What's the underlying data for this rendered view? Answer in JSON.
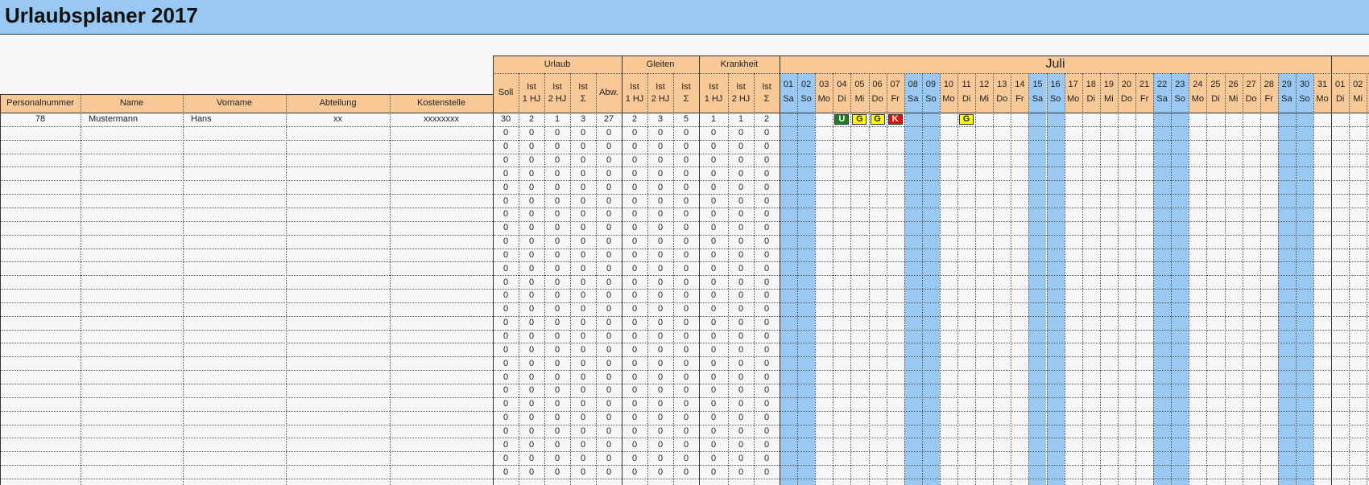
{
  "title": "Urlaubsplaner 2017",
  "groups": {
    "urlaub": "Urlaub",
    "gleiten": "Gleiten",
    "krankheit": "Krankheit"
  },
  "person_headers": [
    "Personalnummer",
    "Name",
    "Vorname",
    "Abteilung",
    "Kostenstelle"
  ],
  "stat_headers": [
    [
      "Soll"
    ],
    [
      "Ist",
      "1 HJ"
    ],
    [
      "Ist",
      "2 HJ"
    ],
    [
      "Ist",
      "Σ"
    ],
    [
      "Abw."
    ],
    [
      "Ist",
      "1 HJ"
    ],
    [
      "Ist",
      "2 HJ"
    ],
    [
      "Ist",
      "Σ"
    ],
    [
      "Ist",
      "1 HJ"
    ],
    [
      "Ist",
      "2 HJ"
    ],
    [
      "Ist",
      "Σ"
    ]
  ],
  "month": "Juli",
  "days": [
    {
      "n": "01",
      "d": "Sa"
    },
    {
      "n": "02",
      "d": "So"
    },
    {
      "n": "03",
      "d": "Mo"
    },
    {
      "n": "04",
      "d": "Di"
    },
    {
      "n": "05",
      "d": "Mi"
    },
    {
      "n": "06",
      "d": "Do"
    },
    {
      "n": "07",
      "d": "Fr"
    },
    {
      "n": "08",
      "d": "Sa"
    },
    {
      "n": "09",
      "d": "So"
    },
    {
      "n": "10",
      "d": "Mo"
    },
    {
      "n": "11",
      "d": "Di"
    },
    {
      "n": "12",
      "d": "Mi"
    },
    {
      "n": "13",
      "d": "Do"
    },
    {
      "n": "14",
      "d": "Fr"
    },
    {
      "n": "15",
      "d": "Sa"
    },
    {
      "n": "16",
      "d": "So"
    },
    {
      "n": "17",
      "d": "Mo"
    },
    {
      "n": "18",
      "d": "Di"
    },
    {
      "n": "19",
      "d": "Mi"
    },
    {
      "n": "20",
      "d": "Do"
    },
    {
      "n": "21",
      "d": "Fr"
    },
    {
      "n": "22",
      "d": "Sa"
    },
    {
      "n": "23",
      "d": "So"
    },
    {
      "n": "24",
      "d": "Mo"
    },
    {
      "n": "25",
      "d": "Di"
    },
    {
      "n": "26",
      "d": "Mi"
    },
    {
      "n": "27",
      "d": "Do"
    },
    {
      "n": "28",
      "d": "Fr"
    },
    {
      "n": "29",
      "d": "Sa"
    },
    {
      "n": "30",
      "d": "So"
    },
    {
      "n": "31",
      "d": "Mo"
    },
    {
      "n": "01",
      "d": "Di"
    },
    {
      "n": "02",
      "d": "Mi"
    }
  ],
  "weekend_day_indexes": [
    0,
    1,
    7,
    8,
    14,
    15,
    21,
    22,
    28,
    29
  ],
  "rows": [
    {
      "personalnummer": "78",
      "name": "Mustermann",
      "vorname": "Hans",
      "abteilung": "xx",
      "kostenstelle": "xxxxxxxx",
      "stats": [
        "30",
        "2",
        "1",
        "3",
        "27",
        "2",
        "3",
        "5",
        "1",
        "1",
        "2"
      ],
      "marks": [
        {
          "day": 3,
          "code": "U",
          "color": "#1e7b1e",
          "text_color": "#ffffff"
        },
        {
          "day": 4,
          "code": "G",
          "color": "#ffff00",
          "text_color": "#222222"
        },
        {
          "day": 5,
          "code": "G",
          "color": "#ffff00",
          "text_color": "#222222"
        },
        {
          "day": 6,
          "code": "K",
          "color": "#e01010",
          "text_color": "#ffffff"
        },
        {
          "day": 10,
          "code": "G",
          "color": "#ffff00",
          "text_color": "#222222"
        }
      ]
    }
  ],
  "empty_row_count": 26,
  "empty_stat_value": "0",
  "colors": {
    "header_blue": "#99c9f3",
    "header_orange": "#f8c896",
    "weekend_blue": "#99c9f3",
    "sheet_background": "#f7f7f7"
  }
}
